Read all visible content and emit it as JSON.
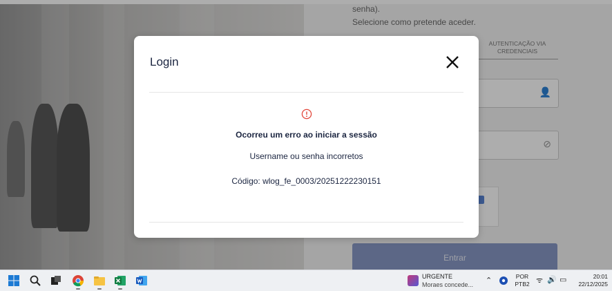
{
  "background": {
    "text_line_1": "senha).",
    "text_line_2": "Selecione como pretende aceder.",
    "tab_label": "AUTENTICAÇÃO VIA CREDENCIAIS",
    "enter_button": "Entrar"
  },
  "modal": {
    "title": "Login",
    "error_title": "Ocorreu um erro ao iniciar a sessão",
    "error_message": "Username ou senha incorretos",
    "error_code": "Código: wlog_fe_0003/20251222230151"
  },
  "taskbar": {
    "news_title": "URGENTE",
    "news_subtitle": "Moraes concede...",
    "language_line_1": "POR",
    "language_line_2": "PTB2",
    "time": "20:01",
    "date": "22/12/2025",
    "icons": [
      "windows-start-icon",
      "search-icon",
      "task-view-icon",
      "chrome-icon",
      "file-explorer-icon",
      "excel-icon",
      "word-icon"
    ]
  },
  "colors": {
    "modal_text": "#1b2540",
    "error_icon": "#e2463a",
    "enter_button": "#7d8fc1"
  }
}
